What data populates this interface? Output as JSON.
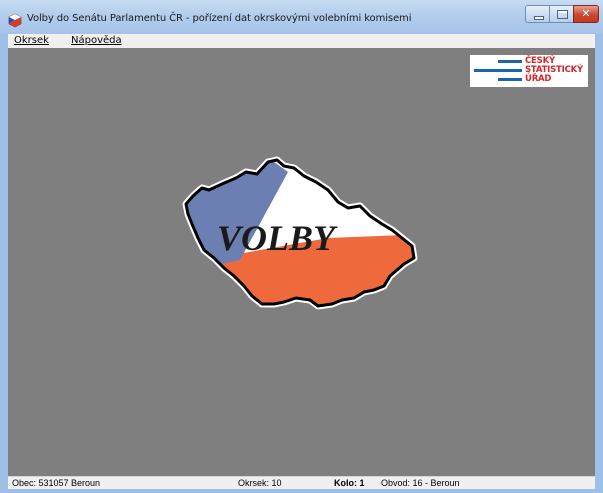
{
  "window": {
    "title": "Volby do Senátu Parlamentu ČR - pořízení dat okrskovými volebními komisemi",
    "icon": "app-flag-icon",
    "controls": {
      "minimize": "minimize-icon",
      "maximize": "maximize-icon",
      "close": "close-icon",
      "close_glyph": "✕"
    }
  },
  "menu": {
    "items": [
      {
        "label": "Okrsek"
      },
      {
        "label": "Nápověda"
      }
    ]
  },
  "logo": {
    "line1": "ČESKÝ",
    "line2": "STATISTICKÝ",
    "line3": "ÚŘAD"
  },
  "splash": {
    "text": "VOLBY",
    "colors": {
      "white": "#ffffff",
      "blue": "#6b7fb2",
      "red": "#ee6a3c",
      "outline": "#000000"
    }
  },
  "status": {
    "obec": "Obec: 531057 Beroun",
    "okrsek": "Okrsek: 10",
    "kolo": "Kolo: 1",
    "obvod": "Obvod: 16 - Beroun"
  },
  "colors": {
    "client_background": "#7f7f7f",
    "logo_blue": "#1b64b0",
    "logo_red": "#d3262a"
  }
}
